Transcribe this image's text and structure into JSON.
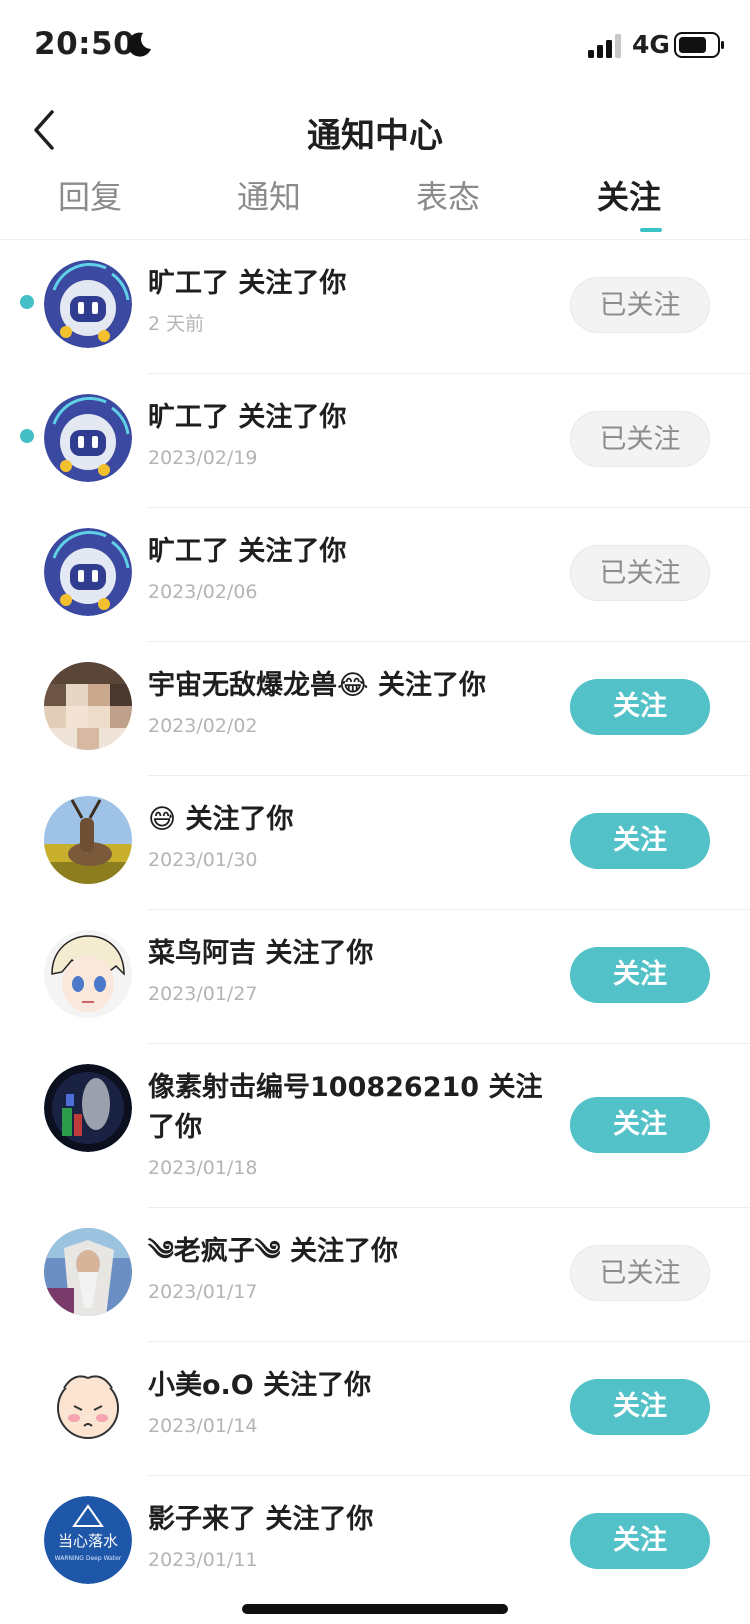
{
  "status_bar": {
    "time": "20:50",
    "network": "4G",
    "moon_icon": "moon-icon",
    "signal_icon": "signal-icon",
    "battery_icon": "battery-icon"
  },
  "header": {
    "title": "通知中心",
    "back_icon": "chevron-left-icon"
  },
  "tabs": [
    {
      "label": "回复",
      "active": false
    },
    {
      "label": "通知",
      "active": false
    },
    {
      "label": "表态",
      "active": false
    },
    {
      "label": "关注",
      "active": true
    }
  ],
  "accent_color": "#3bc3c7",
  "notifications": [
    {
      "title": "旷工了 关注了你",
      "time": "2 天前",
      "button": "已关注",
      "following": true,
      "unread": true,
      "avatar": "robot-avatar"
    },
    {
      "title": "旷工了 关注了你",
      "time": "2023/02/19",
      "button": "已关注",
      "following": true,
      "unread": true,
      "avatar": "robot-avatar"
    },
    {
      "title": "旷工了 关注了你",
      "time": "2023/02/06",
      "button": "已关注",
      "following": true,
      "unread": false,
      "avatar": "robot-avatar"
    },
    {
      "title": "宇宙无敌爆龙兽😂 关注了你",
      "time": "2023/02/02",
      "button": "关注",
      "following": false,
      "unread": false,
      "avatar": "pixelated-avatar"
    },
    {
      "title": "😅 关注了你",
      "time": "2023/01/30",
      "button": "关注",
      "following": false,
      "unread": false,
      "avatar": "antelope-avatar"
    },
    {
      "title": "菜鸟阿吉 关注了你",
      "time": "2023/01/27",
      "button": "关注",
      "following": false,
      "unread": false,
      "avatar": "anime-avatar"
    },
    {
      "title": "像素射击编号100826210 关注了你",
      "time": "2023/01/18",
      "button": "关注",
      "following": false,
      "unread": false,
      "avatar": "dark-avatar"
    },
    {
      "title": "༄老疯子༄ 关注了你",
      "time": "2023/01/17",
      "button": "已关注",
      "following": true,
      "unread": false,
      "avatar": "wizard-avatar"
    },
    {
      "title": "小美o.O 关注了你",
      "time": "2023/01/14",
      "button": "关注",
      "following": false,
      "unread": false,
      "avatar": "cartoon-avatar"
    },
    {
      "title": "影子来了 关注了你",
      "time": "2023/01/11",
      "button": "关注",
      "following": false,
      "unread": false,
      "avatar": "sign-avatar"
    }
  ],
  "avatar_sign": {
    "line1": "当心落水",
    "line2": "WARNING Deep Water"
  }
}
